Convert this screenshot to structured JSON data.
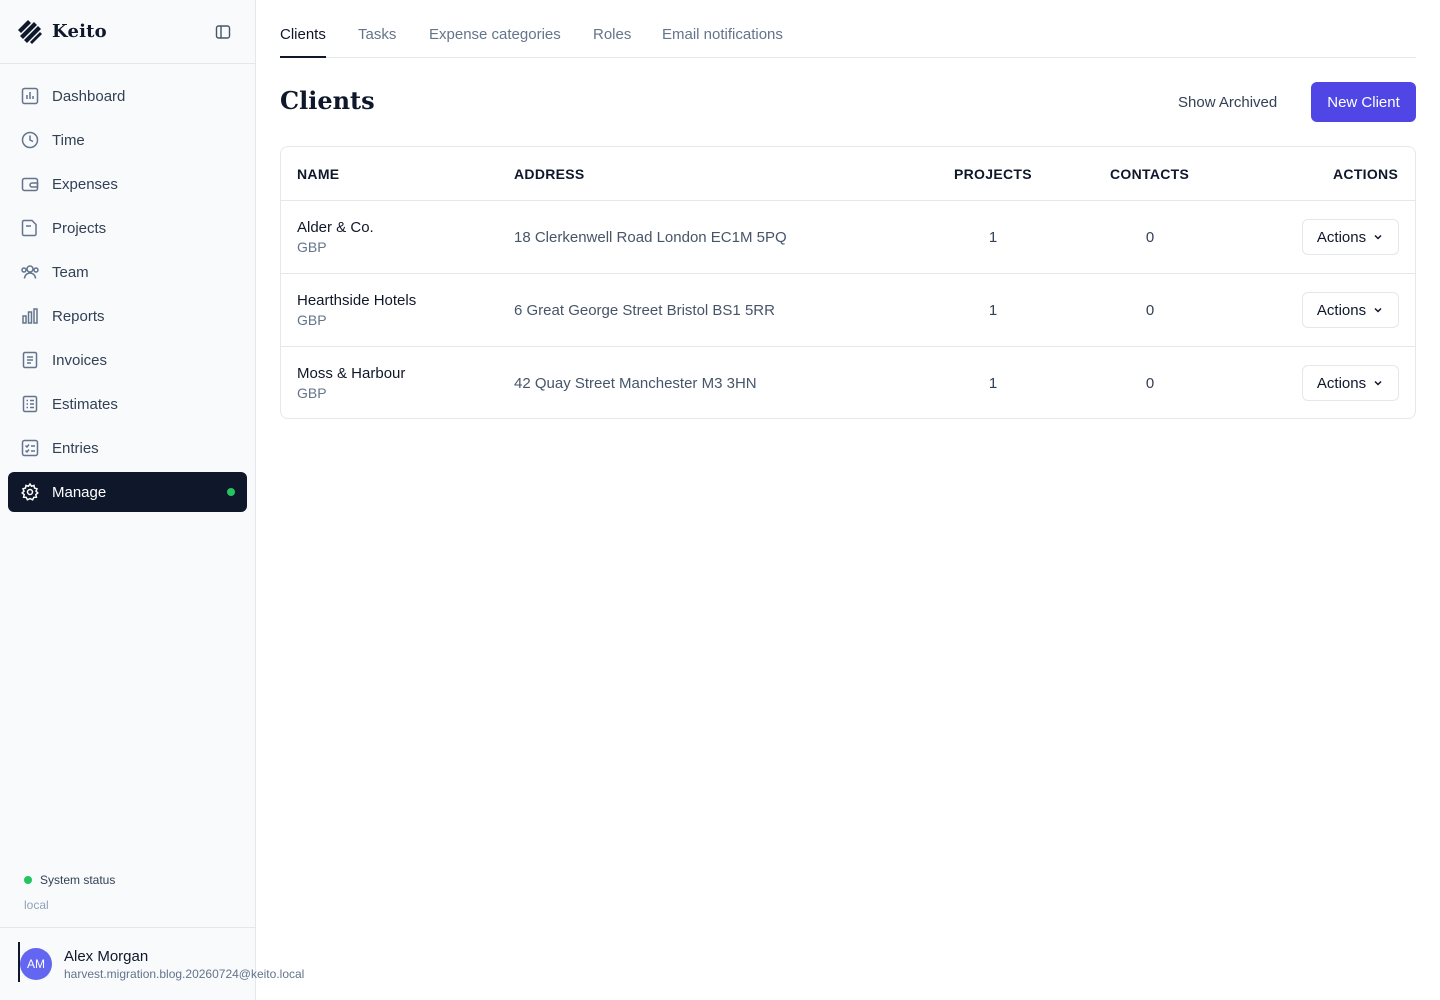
{
  "app": {
    "name": "Keito"
  },
  "sidebar": {
    "items": [
      {
        "label": "Dashboard",
        "icon": "dashboard-icon"
      },
      {
        "label": "Time",
        "icon": "clock-icon"
      },
      {
        "label": "Expenses",
        "icon": "wallet-icon"
      },
      {
        "label": "Projects",
        "icon": "folder-icon"
      },
      {
        "label": "Team",
        "icon": "users-icon"
      },
      {
        "label": "Reports",
        "icon": "bar-chart-icon"
      },
      {
        "label": "Invoices",
        "icon": "invoice-icon"
      },
      {
        "label": "Estimates",
        "icon": "estimate-icon"
      },
      {
        "label": "Entries",
        "icon": "checklist-icon"
      },
      {
        "label": "Manage",
        "icon": "gear-icon",
        "active": true
      }
    ],
    "status": {
      "label": "System status",
      "env": "local"
    },
    "user": {
      "initials": "AM",
      "name": "Alex Morgan",
      "email": "harvest.migration.blog.20260724@keito.local"
    }
  },
  "tabs": [
    {
      "label": "Clients",
      "active": true
    },
    {
      "label": "Tasks"
    },
    {
      "label": "Expense categories"
    },
    {
      "label": "Roles"
    },
    {
      "label": "Email notifications"
    }
  ],
  "page": {
    "title": "Clients",
    "show_archived_label": "Show Archived",
    "new_client_label": "New Client"
  },
  "table": {
    "headers": {
      "name": "NAME",
      "address": "ADDRESS",
      "projects": "PROJECTS",
      "contacts": "CONTACTS",
      "actions": "ACTIONS"
    },
    "rows": [
      {
        "name": "Alder & Co.",
        "currency": "GBP",
        "address": "18 Clerkenwell Road London EC1M 5PQ",
        "projects": "1",
        "contacts": "0",
        "actions_label": "Actions"
      },
      {
        "name": "Hearthside Hotels",
        "currency": "GBP",
        "address": "6 Great George Street Bristol BS1 5RR",
        "projects": "1",
        "contacts": "0",
        "actions_label": "Actions"
      },
      {
        "name": "Moss & Harbour",
        "currency": "GBP",
        "address": "42 Quay Street Manchester M3 3HN",
        "projects": "1",
        "contacts": "0",
        "actions_label": "Actions"
      }
    ]
  },
  "colors": {
    "primary": "#4f46e5",
    "active_nav": "#0f172a",
    "status_green": "#22c55e"
  }
}
